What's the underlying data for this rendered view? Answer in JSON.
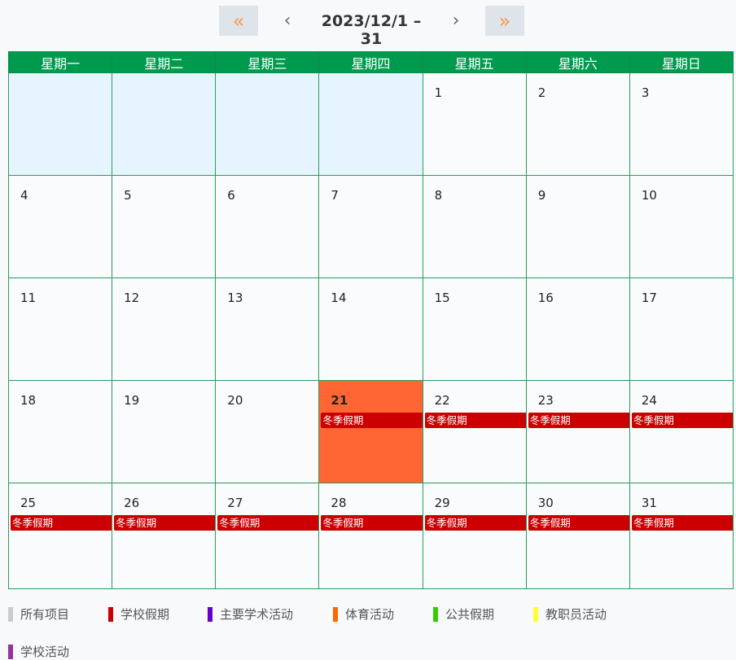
{
  "nav": {
    "prev_year_icon": "«",
    "prev_month_icon": "‹",
    "title": "2023/12/1 – 31",
    "next_month_icon": "›",
    "next_year_icon": "»"
  },
  "weekdays": [
    "星期一",
    "星期二",
    "星期三",
    "星期四",
    "星期五",
    "星期六",
    "星期日"
  ],
  "weeks": [
    [
      {
        "day": ""
      },
      {
        "day": ""
      },
      {
        "day": ""
      },
      {
        "day": ""
      },
      {
        "day": "1"
      },
      {
        "day": "2"
      },
      {
        "day": "3"
      }
    ],
    [
      {
        "day": "4"
      },
      {
        "day": "5"
      },
      {
        "day": "6"
      },
      {
        "day": "7"
      },
      {
        "day": "8"
      },
      {
        "day": "9"
      },
      {
        "day": "10"
      }
    ],
    [
      {
        "day": "11"
      },
      {
        "day": "12"
      },
      {
        "day": "13"
      },
      {
        "day": "14"
      },
      {
        "day": "15"
      },
      {
        "day": "16"
      },
      {
        "day": "17"
      }
    ],
    [
      {
        "day": "18"
      },
      {
        "day": "19"
      },
      {
        "day": "20"
      },
      {
        "day": "21",
        "today": true,
        "event": "冬季假期"
      },
      {
        "day": "22",
        "event": "冬季假期"
      },
      {
        "day": "23",
        "event": "冬季假期"
      },
      {
        "day": "24",
        "event": "冬季假期"
      }
    ],
    [
      {
        "day": "25",
        "event": "冬季假期"
      },
      {
        "day": "26",
        "event": "冬季假期"
      },
      {
        "day": "27",
        "event": "冬季假期"
      },
      {
        "day": "28",
        "event": "冬季假期"
      },
      {
        "day": "29",
        "event": "冬季假期"
      },
      {
        "day": "30",
        "event": "冬季假期"
      },
      {
        "day": "31",
        "event": "冬季假期"
      }
    ]
  ],
  "legend": [
    {
      "label": "所有项目",
      "color": "#cccccc"
    },
    {
      "label": "学校假期",
      "color": "#cc0000"
    },
    {
      "label": "主要学术活动",
      "color": "#6600cc"
    },
    {
      "label": "体育活动",
      "color": "#ff6600"
    },
    {
      "label": "公共假期",
      "color": "#33cc00"
    },
    {
      "label": "教职员活动",
      "color": "#ffff33"
    },
    {
      "label": "学校活动",
      "color": "#993399"
    }
  ],
  "colors": {
    "header_bg": "#009a4e",
    "today_bg": "#ff6633",
    "event_bg": "#cc0000",
    "empty_bg": "#e6f5fd"
  }
}
